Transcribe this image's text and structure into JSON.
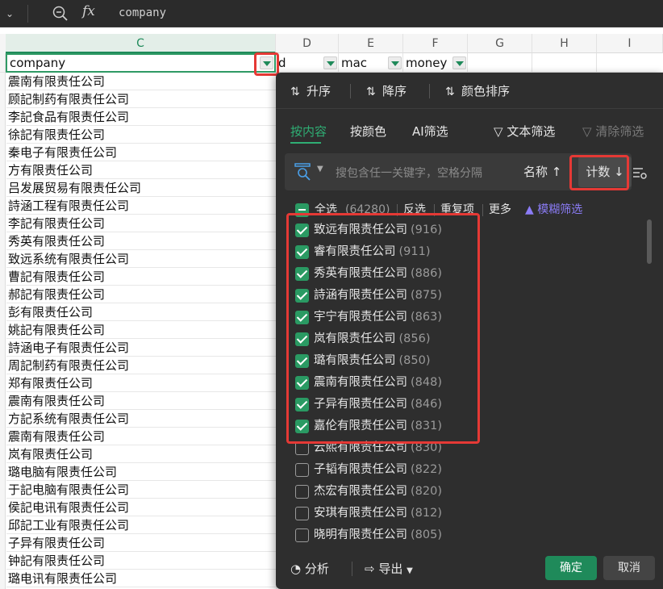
{
  "formula_bar": {
    "value": "company"
  },
  "columns": [
    "C",
    "D",
    "E",
    "F",
    "G",
    "H",
    "I"
  ],
  "header_row": {
    "c": "company",
    "d": "d",
    "e": "mac",
    "f": "money"
  },
  "rows": [
    "震南有限责任公司",
    "顾記制药有限责任公司",
    "李記食品有限责任公司",
    "徐記有限责任公司",
    "秦电子有限责任公司",
    "方有限责任公司",
    "吕发展贸易有限责任公司",
    "詩涵工程有限责任公司",
    "李記有限责任公司",
    "秀英有限责任公司",
    "致远系统有限责任公司",
    "曹記有限责任公司",
    "郝記有限责任公司",
    "彭有限责任公司",
    "姚記有限责任公司",
    "詩涵电子有限责任公司",
    "周記制药有限责任公司",
    "郑有限责任公司",
    "震南有限责任公司",
    "方記系统有限责任公司",
    "震南有限责任公司",
    "岚有限责任公司",
    "璐电脑有限责任公司",
    "于記电脑有限责任公司",
    "侯記电讯有限责任公司",
    "邱記工业有限责任公司",
    "子异有限责任公司",
    "钟記有限责任公司",
    "璐电讯有限责任公司"
  ],
  "panel": {
    "sort": {
      "asc": "升序",
      "desc": "降序",
      "color": "颜色排序"
    },
    "tabs": {
      "content": "按内容",
      "color": "按颜色",
      "ai": "AI筛选",
      "text_filter": "文本筛选",
      "clear_filter": "清除筛选"
    },
    "search": {
      "placeholder": "搜包含任一关键字，空格分隔",
      "sort_name": "名称 ↑",
      "sort_count": "计数 ↓"
    },
    "list_header": {
      "select_all": "全选",
      "total": "(64280)",
      "invert": "反选",
      "duplicates": "重复项",
      "more": "更多",
      "fuzzy": "模糊筛选"
    },
    "items": [
      {
        "label": "致远有限责任公司",
        "count": "(916)",
        "checked": true
      },
      {
        "label": "睿有限责任公司",
        "count": "(911)",
        "checked": true
      },
      {
        "label": "秀英有限责任公司",
        "count": "(886)",
        "checked": true
      },
      {
        "label": "詩涵有限责任公司",
        "count": "(875)",
        "checked": true
      },
      {
        "label": "宇宁有限责任公司",
        "count": "(863)",
        "checked": true
      },
      {
        "label": "岚有限责任公司",
        "count": "(856)",
        "checked": true
      },
      {
        "label": "璐有限责任公司",
        "count": "(850)",
        "checked": true
      },
      {
        "label": "震南有限责任公司",
        "count": "(848)",
        "checked": true
      },
      {
        "label": "子异有限责任公司",
        "count": "(846)",
        "checked": true
      },
      {
        "label": "嘉伦有限责任公司",
        "count": "(831)",
        "checked": true
      },
      {
        "label": "云熙有限责任公司",
        "count": "(830)",
        "checked": false
      },
      {
        "label": "子韬有限责任公司",
        "count": "(822)",
        "checked": false
      },
      {
        "label": "杰宏有限责任公司",
        "count": "(820)",
        "checked": false
      },
      {
        "label": "安琪有限责任公司",
        "count": "(812)",
        "checked": false
      },
      {
        "label": "晓明有限责任公司",
        "count": "(805)",
        "checked": false
      }
    ],
    "footer": {
      "analyze": "分析",
      "export": "导出",
      "ok": "确定",
      "cancel": "取消"
    }
  },
  "colors": {
    "accent": "#2fae74",
    "highlight": "#e53935",
    "panel_bg": "#2e2e2e"
  }
}
